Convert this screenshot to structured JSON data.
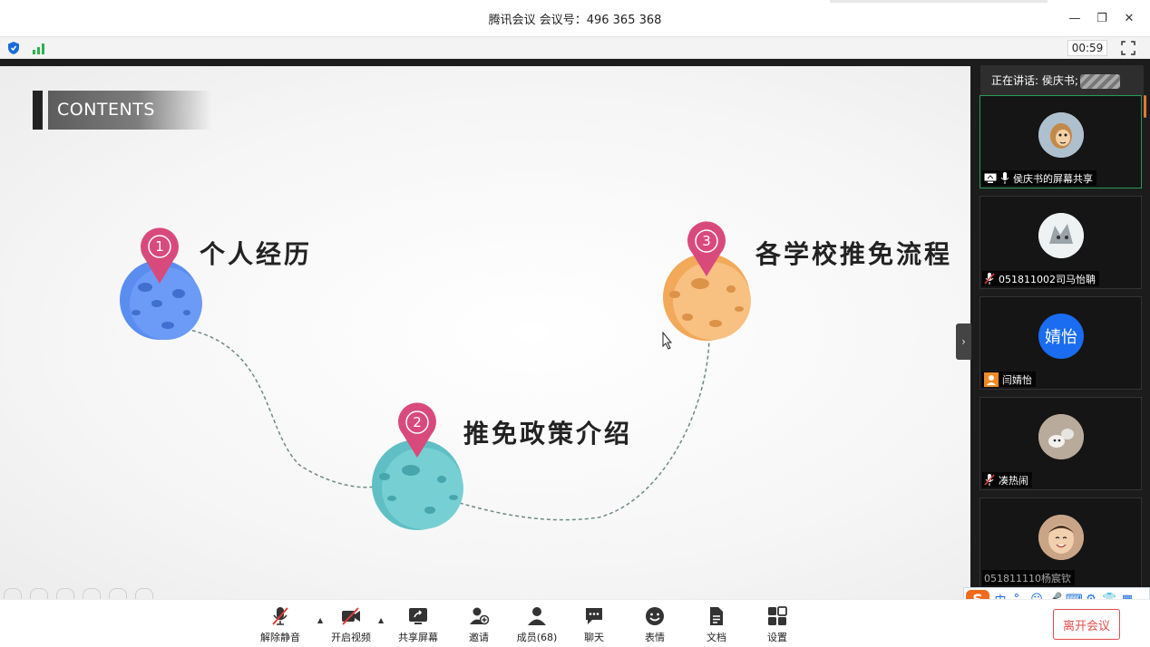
{
  "window": {
    "title": "腾讯会议 会议号：496 365 368",
    "minimize_label": "—",
    "restore_label": "❐",
    "close_label": "✕"
  },
  "status": {
    "timer": "00:59",
    "shield_color": "#1a6cd8",
    "signal_color": "#2ab24f"
  },
  "slide": {
    "contents_title": "CONTENTS",
    "items": [
      {
        "number": "1",
        "label": "个人经历",
        "planet_color": "#5b8df0"
      },
      {
        "number": "2",
        "label": "推免政策介绍",
        "planet_color": "#6cc8cc"
      },
      {
        "number": "3",
        "label": "各学校推免流程",
        "planet_color": "#f6b46a"
      }
    ],
    "pin_color": "#d94a7c",
    "collapse_label": "›"
  },
  "panel": {
    "speaking": "正在讲话: 侯庆书;",
    "participants": [
      {
        "name": "侯庆书的屏幕共享",
        "mic": "on",
        "screen_share": true,
        "avatar_icon": "cartoon-avatar-icon"
      },
      {
        "name": "051811002司马怡聃",
        "mic": "muted",
        "avatar_icon": "wolf-avatar-icon"
      },
      {
        "name": "闫婧怡",
        "mic": "none",
        "avatar_text": "婧怡",
        "avatar_color": "#1a6cf0",
        "badge_color": "#f08a24"
      },
      {
        "name": "凑热闹",
        "mic": "muted",
        "avatar_icon": "cat-avatar-icon"
      },
      {
        "name": "051811110杨宸钦",
        "mic": "none",
        "avatar_icon": "baby-avatar-icon"
      }
    ]
  },
  "ime": {
    "logo": "S",
    "items": [
      "中",
      "°,",
      "☺",
      "🎤",
      "⌨",
      "⚙",
      "👕",
      "▦"
    ]
  },
  "toolbar": {
    "buttons": [
      {
        "label": "解除静音"
      },
      {
        "label": "开启视频"
      },
      {
        "label": "共享屏幕"
      },
      {
        "label": "邀请"
      },
      {
        "label": "成员(68)"
      },
      {
        "label": "聊天"
      },
      {
        "label": "表情"
      },
      {
        "label": "文档"
      },
      {
        "label": "设置"
      }
    ],
    "leave_label": "离开会议",
    "leave_color": "#e14b4b"
  }
}
